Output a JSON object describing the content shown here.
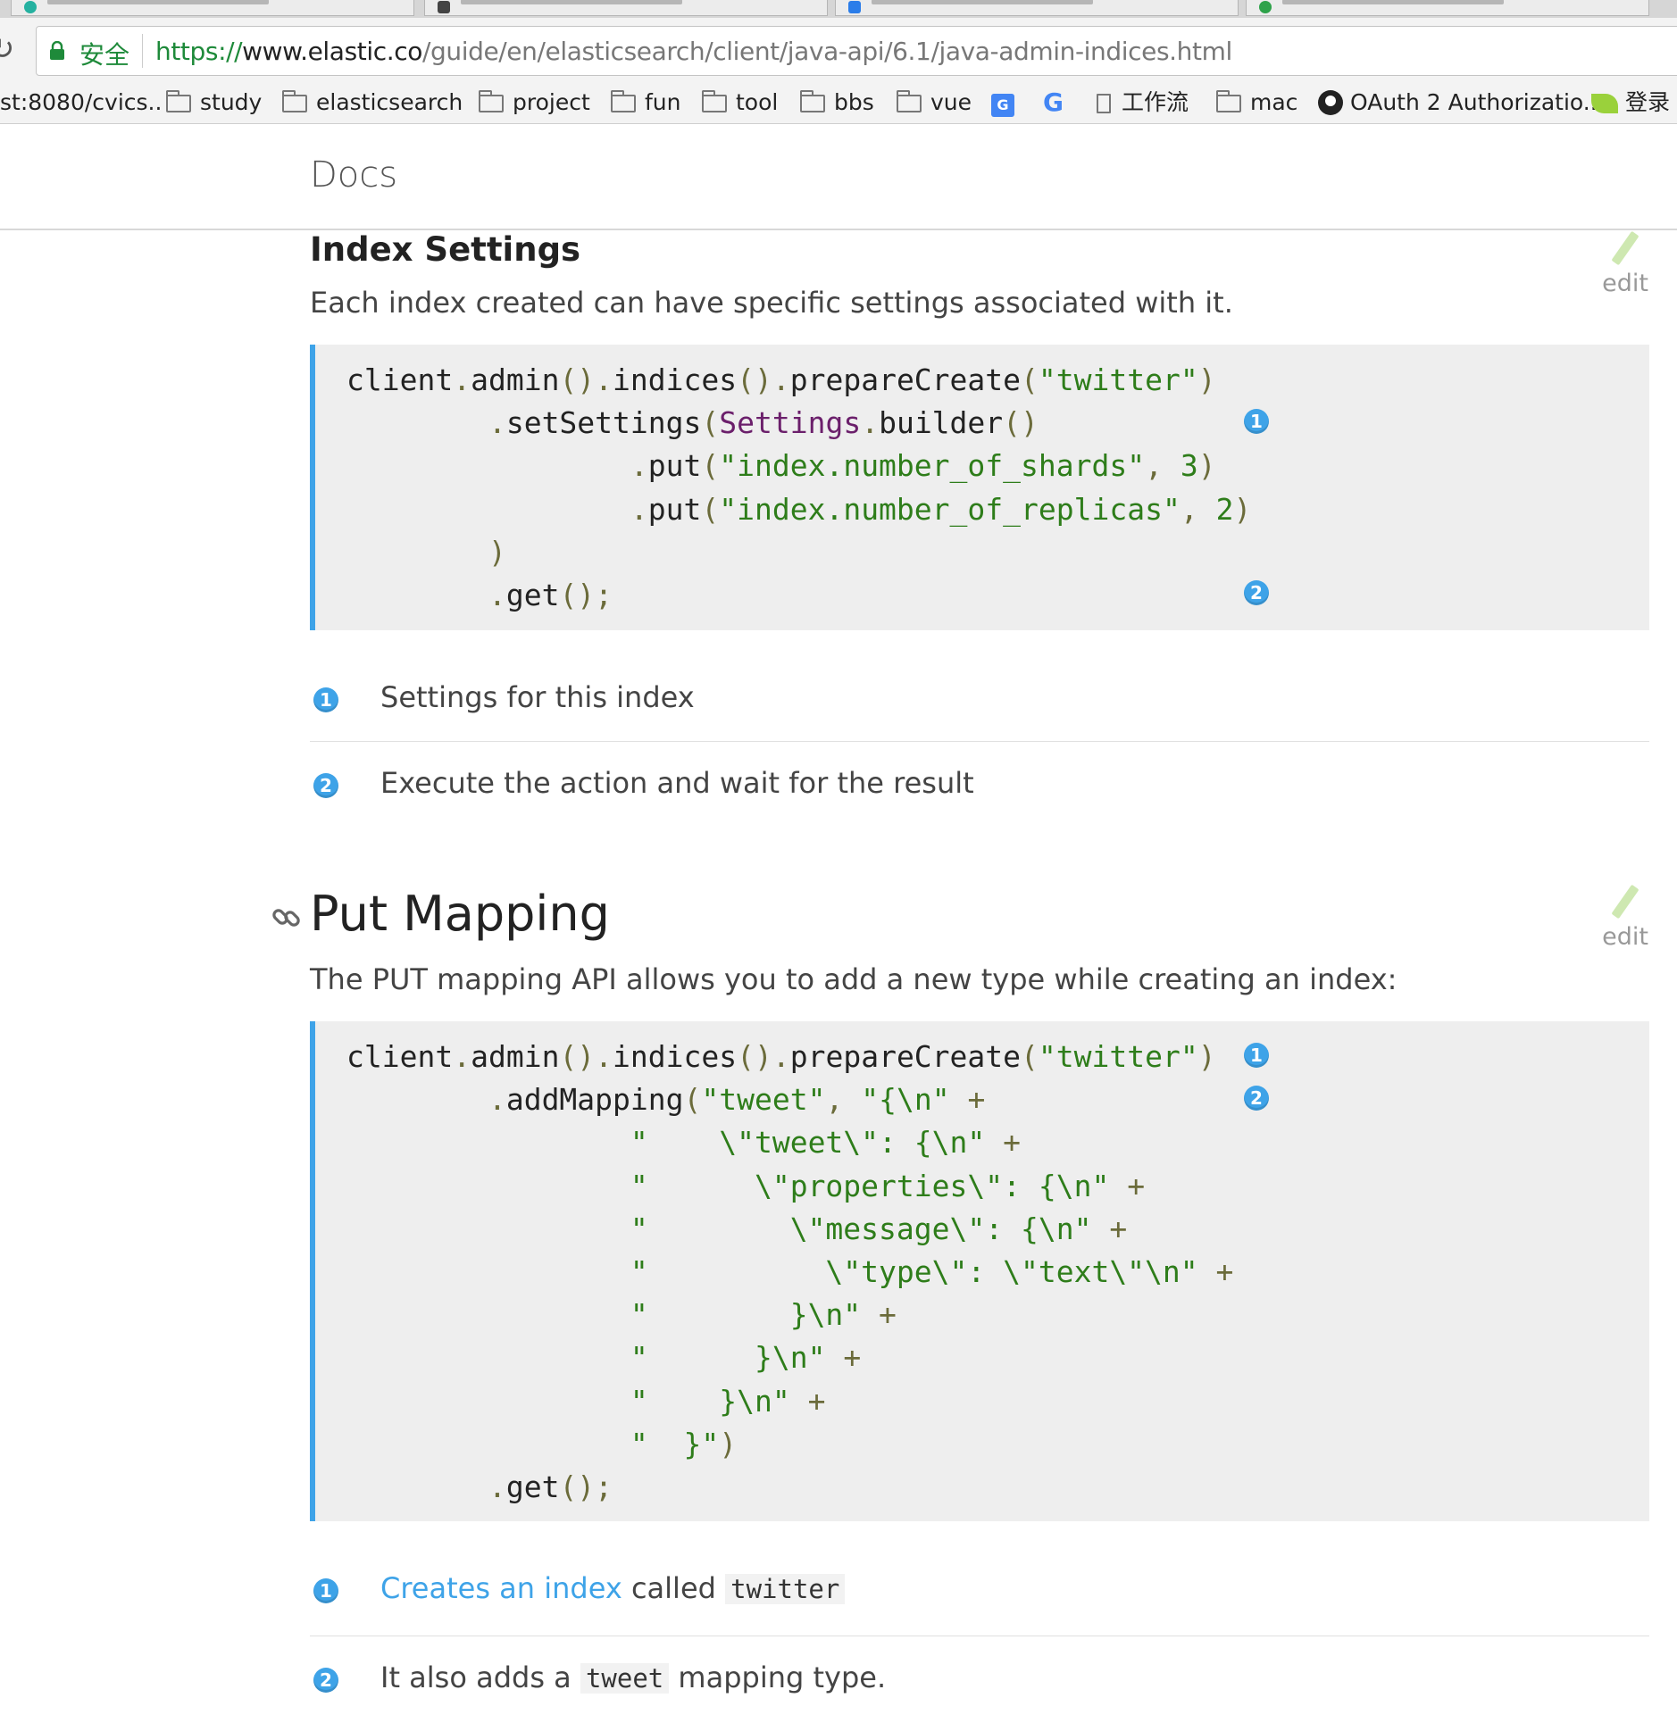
{
  "browser": {
    "secure_label": "安全",
    "url_scheme": "https://",
    "url_host": "www.elastic.co",
    "url_path": "/guide/en/elasticsearch/client/java-api/6.1/java-admin-indices.html"
  },
  "bookmarks": [
    {
      "label": "st:8080/cvics..",
      "icon": "none"
    },
    {
      "label": "study",
      "icon": "folder-icon"
    },
    {
      "label": "elasticsearch",
      "icon": "folder-icon"
    },
    {
      "label": "project",
      "icon": "folder-icon"
    },
    {
      "label": "fun",
      "icon": "folder-icon"
    },
    {
      "label": "tool",
      "icon": "folder-icon"
    },
    {
      "label": "bbs",
      "icon": "folder-icon"
    },
    {
      "label": "vue",
      "icon": "folder-icon"
    },
    {
      "label": "",
      "icon": "translate-icon"
    },
    {
      "label": "G",
      "icon": "google-icon"
    },
    {
      "label": "工作流",
      "icon": "page-icon"
    },
    {
      "label": "mac",
      "icon": "folder-icon"
    },
    {
      "label": "OAuth 2 Authorizatio...",
      "icon": "github-icon"
    },
    {
      "label": "登录",
      "icon": "leaf-icon"
    }
  ],
  "header": {
    "title": "Docs"
  },
  "index_settings": {
    "heading": "Index Settings",
    "edit_label": "edit",
    "intro": "Each index created can have specific settings associated with it.",
    "callouts": [
      {
        "num": "1",
        "text": "Settings for this index"
      },
      {
        "num": "2",
        "text": "Execute the action and wait for the result"
      }
    ]
  },
  "put_mapping": {
    "heading": "Put Mapping",
    "edit_label": "edit",
    "intro": "The PUT mapping API allows you to add a new type while creating an index:",
    "callout1": {
      "num": "1",
      "link_text": "Creates an index",
      "middle": " called ",
      "code": "twitter"
    },
    "callout2": {
      "num": "2",
      "before": "It also adds a ",
      "code": "tweet",
      "after": " mapping type."
    }
  },
  "accent_color": "#3ea3e8"
}
